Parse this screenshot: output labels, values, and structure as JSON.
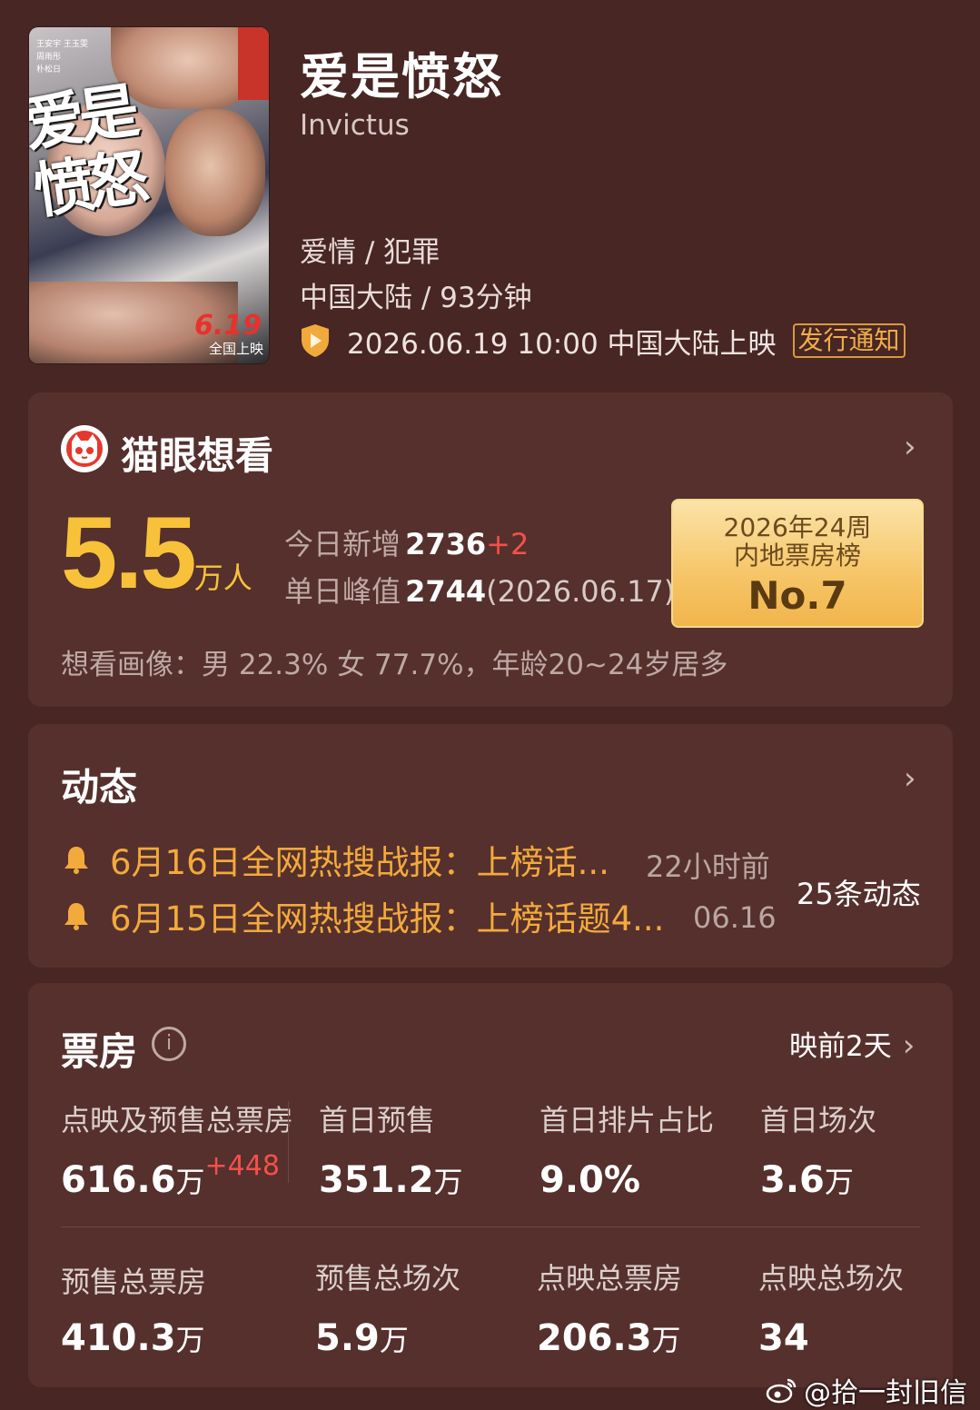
{
  "movie": {
    "title_cn": "爱是愤怒",
    "title_en": "Invictus",
    "genre": "爱情 / 犯罪",
    "region_duration": "中国大陆 / 93分钟",
    "release": "2026.06.19 10:00 中国大陆上映",
    "notify_label": "发行通知",
    "poster": {
      "title": "爱是愤怒",
      "date": "6.19",
      "release": "全国上映",
      "credits_line1": "王安宇 王玉雯",
      "credits_line2": "周雨彤",
      "credits_line3": "朴松日"
    }
  },
  "want": {
    "header": "猫眼想看",
    "count": "5.5",
    "unit": "万人",
    "today_label": "今日新增",
    "today_value": "2736",
    "today_delta": "+2",
    "peak_label": "单日峰值",
    "peak_value": "2744",
    "peak_date": "(2026.06.17)",
    "rank_line1": "2026年24周",
    "rank_line2": "内地票房榜",
    "rank_no": "No.7",
    "portrait": "想看画像：男 22.3%  女 77.7%，年龄20~24岁居多"
  },
  "news": {
    "header": "动态",
    "items": [
      {
        "title": "6月16日全网热搜战报：上榜话...",
        "time": "22小时前"
      },
      {
        "title": "6月15日全网热搜战报：上榜话题4...",
        "time": "06.16"
      }
    ],
    "count": "25条动态"
  },
  "boxoffice": {
    "header": "票房",
    "status": "映前2天",
    "stats_top": [
      {
        "label": "点映及预售总票房",
        "value": "616.6",
        "unit": "万",
        "delta": "+448"
      },
      {
        "label": "首日预售",
        "value": "351.2",
        "unit": "万"
      },
      {
        "label": "首日排片占比",
        "value": "9.0%",
        "unit": ""
      },
      {
        "label": "首日场次",
        "value": "3.6",
        "unit": "万"
      }
    ],
    "stats_bottom": [
      {
        "label": "预售总票房",
        "value": "410.3",
        "unit": "万"
      },
      {
        "label": "预售总场次",
        "value": "5.9",
        "unit": "万"
      },
      {
        "label": "点映总票房",
        "value": "206.3",
        "unit": "万"
      },
      {
        "label": "点映总场次",
        "value": "34",
        "unit": ""
      }
    ]
  },
  "watermark": "@拾一封旧信",
  "colors": {
    "background": "#472624",
    "card": "#55302d",
    "accent": "#f7c23a",
    "highlight": "#f3aa3c",
    "red": "#f4504a"
  }
}
